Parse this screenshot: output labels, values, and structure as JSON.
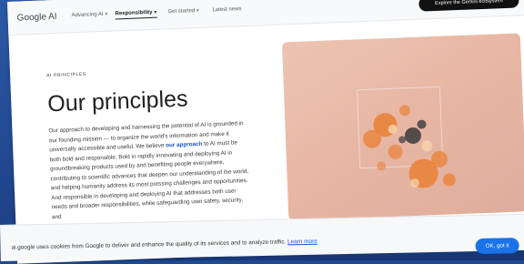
{
  "nav": {
    "logo": "Google AI",
    "links": [
      {
        "label": "Advancing AI",
        "dropdown": true
      },
      {
        "label": "Responsibility",
        "dropdown": true,
        "active": true
      },
      {
        "label": "Get started",
        "dropdown": true
      },
      {
        "label": "Latest news",
        "dropdown": false
      }
    ],
    "cta": "Explore the Gemini ecosystem"
  },
  "hero": {
    "eyebrow": "AI PRINCIPLES",
    "title": "Our principles",
    "body_pre": "Our approach to developing and harnessing the potential of AI is grounded in our founding mission — to organize the world's information and make it universally accessible and useful. We believe",
    "body_link": "our approach",
    "body_post": "to AI must be both bold and responsible. Bold in rapidly innovating and deploying AI in groundbreaking products used by and benefiting people everywhere, contributing to scientific advances that deepen our understanding of the world, and helping humanity address its most pressing challenges and opportunities. And responsible in developing and deploying AI that addresses both user needs and broader responsibilities, while safeguarding user safety, security, and"
  },
  "cookie": {
    "text": "ai.google uses cookies from Google to deliver and enhance the quality of its services and to analyze traffic.",
    "link": "Learn more",
    "button": "OK, got it"
  },
  "colors": {
    "accent": "#1a73e8",
    "cta_bg": "#111111",
    "art_bg": "#e8b7a4",
    "particles_orange": "#e8833a",
    "particles_dark": "#3a3a3a"
  }
}
